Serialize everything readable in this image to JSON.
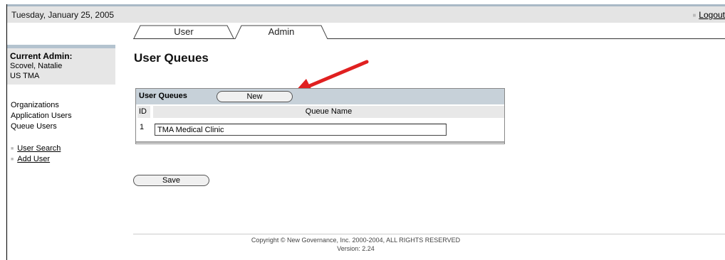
{
  "header": {
    "date": "Tuesday, January 25, 2005",
    "logout_label": "Logout"
  },
  "tabs": [
    {
      "label": "User",
      "active": false
    },
    {
      "label": "Admin",
      "active": true
    }
  ],
  "admin_box": {
    "title": "Current Admin:",
    "name": "Scovel, Natalie",
    "org": "US TMA"
  },
  "nav": {
    "items": [
      "Organizations",
      "Application Users",
      "Queue Users"
    ]
  },
  "sub_nav": {
    "items": [
      "User Search",
      "Add User"
    ]
  },
  "main": {
    "page_title": "User Queues",
    "table": {
      "header_label": "User Queues",
      "new_button_label": "New",
      "columns": [
        "ID",
        "Queue Name"
      ],
      "rows": [
        {
          "id": "1",
          "queue_name": "TMA Medical Clinic"
        }
      ]
    },
    "save_button_label": "Save"
  },
  "footer": {
    "copyright": "Copyright © New Governance, Inc. 2000-2004, ALL RIGHTS RESERVED",
    "version": "Version: 2.24"
  },
  "colors": {
    "header_bar": "#e4e4e4",
    "accent_strip": "#a9b9c6",
    "table_header": "#c7d1d9",
    "arrow": "#e02020"
  },
  "annotation": {
    "type": "red-arrow",
    "points_to": "new-button"
  }
}
